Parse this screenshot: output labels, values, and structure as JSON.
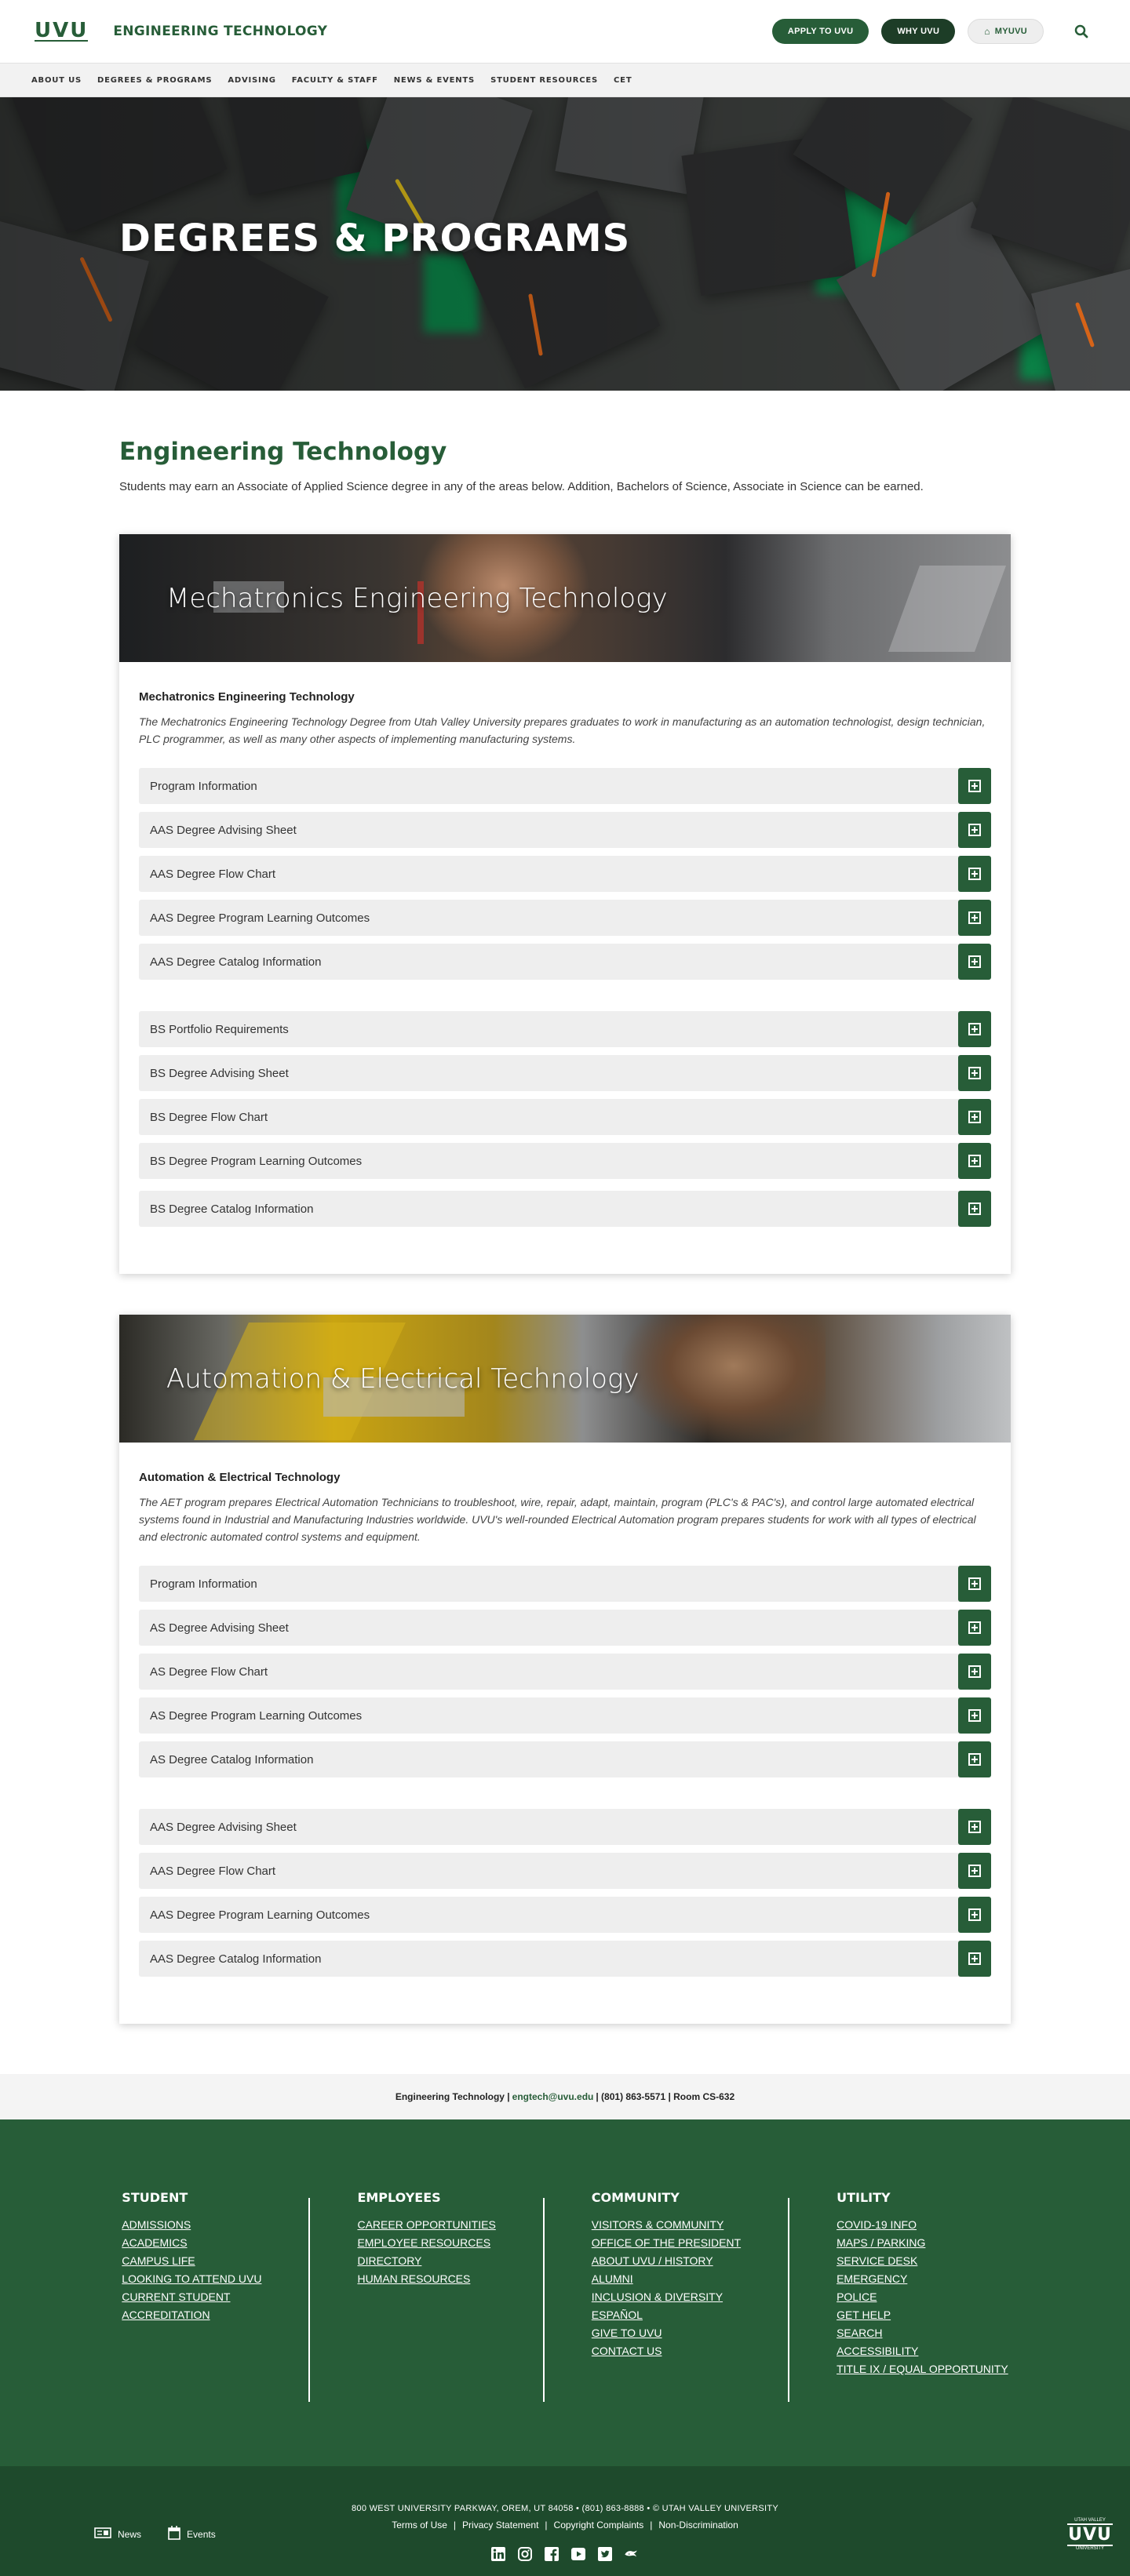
{
  "header": {
    "logo": "UVU",
    "site_title": "ENGINEERING TECHNOLOGY",
    "apply_label": "APPLY TO UVU",
    "why_label": "WHY UVU",
    "myuvu_label": "MYUVU"
  },
  "nav": [
    "ABOUT US",
    "DEGREES & PROGRAMS",
    "ADVISING",
    "FACULTY & STAFF",
    "NEWS & EVENTS",
    "STUDENT RESOURCES",
    "CET"
  ],
  "hero": {
    "title": "DEGREES & PROGRAMS"
  },
  "main": {
    "heading": "Engineering Technology",
    "intro": "Students may earn an Associate of Applied Science degree in any of the areas below. Addition, Bachelors of Science, Associate in Science can be earned."
  },
  "programs": [
    {
      "banner_title": "Mechatronics Engineering Technology",
      "subtitle": "Mechatronics Engineering Technology",
      "description": "The Mechatronics Engineering Technology Degree from Utah Valley University prepares graduates to work in manufacturing as an automation technologist, design technician, PLC programmer, as well as many other aspects of implementing manufacturing systems.",
      "group1": [
        "Program Information",
        "AAS Degree Advising Sheet",
        "AAS Degree Flow Chart",
        "AAS Degree Program Learning Outcomes",
        "AAS Degree Catalog Information"
      ],
      "group2": [
        "BS Portfolio Requirements",
        "BS Degree Advising Sheet",
        "BS Degree Flow Chart",
        "BS Degree Program Learning Outcomes",
        "BS Degree Catalog Information"
      ]
    },
    {
      "banner_title": "Automation & Electrical Technology",
      "subtitle": "Automation & Electrical Technology",
      "description": "The AET program prepares Electrical Automation Technicians to troubleshoot, wire, repair, adapt, maintain, program (PLC's & PAC's), and control large automated electrical systems found in Industrial and Manufacturing Industries worldwide. UVU's well-rounded Electrical Automation program prepares students for work with all types of electrical and electronic automated control systems and equipment.",
      "group1": [
        "Program Information",
        "AS Degree Advising Sheet",
        "AS Degree Flow Chart",
        "AS Degree Program Learning Outcomes",
        "AS Degree Catalog Information"
      ],
      "group2": [
        "AAS Degree Advising Sheet",
        "AAS Degree Flow Chart",
        "AAS Degree Program Learning Outcomes",
        "AAS Degree Catalog Information"
      ]
    }
  ],
  "contact": {
    "name": "Engineering Technology |",
    "email": "engtech@uvu.edu",
    "rest": "| (801) 863-5571 | Room CS-632"
  },
  "footer": {
    "columns": [
      {
        "title": "STUDENT",
        "links": [
          "ADMISSIONS",
          "ACADEMICS",
          "CAMPUS LIFE",
          "LOOKING TO ATTEND UVU",
          "CURRENT STUDENT",
          "ACCREDITATION"
        ]
      },
      {
        "title": "EMPLOYEES",
        "links": [
          "CAREER OPPORTUNITIES",
          "EMPLOYEE RESOURCES",
          "DIRECTORY",
          "HUMAN RESOURCES"
        ]
      },
      {
        "title": "COMMUNITY",
        "links": [
          "VISITORS & COMMUNITY",
          "OFFICE OF THE PRESIDENT",
          "ABOUT UVU / HISTORY",
          "ALUMNI",
          "INCLUSION & DIVERSITY",
          "ESPAÑOL",
          "GIVE TO UVU",
          "CONTACT US"
        ]
      },
      {
        "title": "UTILITY",
        "links": [
          "COVID-19 INFO",
          "MAPS / PARKING",
          "SERVICE DESK",
          "EMERGENCY",
          "POLICE",
          "GET HELP",
          "SEARCH",
          "ACCESSIBILITY",
          "TITLE IX / EQUAL OPPORTUNITY"
        ]
      }
    ],
    "address": "800 WEST UNIVERSITY PARKWAY, OREM, UT 84058  •  (801) 863-8888  •  © UTAH VALLEY UNIVERSITY",
    "legal_links": [
      "Terms of Use",
      "Privacy Statement",
      "Copyright Complaints",
      "Non-Discrimination"
    ],
    "news_label": "News",
    "events_label": "Events",
    "logo_small": "UTAH VALLEY",
    "logo_big": "UVU",
    "logo_bottom": "UNIVERSITY"
  },
  "colors": {
    "brand_green": "#275d38",
    "dark_green": "#1e4a2c",
    "accordion_bg": "#eeeeee"
  }
}
